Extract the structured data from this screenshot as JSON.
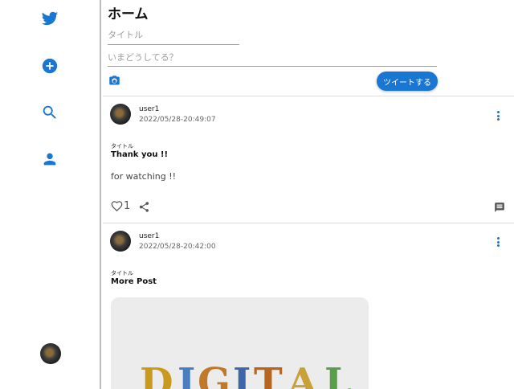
{
  "sidebar": {
    "items": [
      {
        "icon": "twitter-bird-icon"
      },
      {
        "icon": "add-circle-icon"
      },
      {
        "icon": "search-icon"
      },
      {
        "icon": "person-icon"
      }
    ]
  },
  "header": {
    "title": "ホーム"
  },
  "compose": {
    "title_placeholder": "タイトル",
    "body_placeholder": "いまどうしてる？",
    "submit_label": "ツイートする"
  },
  "posts": [
    {
      "username": "user1",
      "timestamp": "2022/05/28-20:49:07",
      "title_label": "タイトル",
      "title": "Thank you !!",
      "body": "for watching !!",
      "like_count": "1"
    },
    {
      "username": "user1",
      "timestamp": "2022/05/28-20:42:00",
      "title_label": "タイトル",
      "title": "More Post",
      "image_text": "DIGITAL"
    }
  ],
  "colors": {
    "accent": "#1976d2",
    "divider": "#dcdcdc"
  }
}
